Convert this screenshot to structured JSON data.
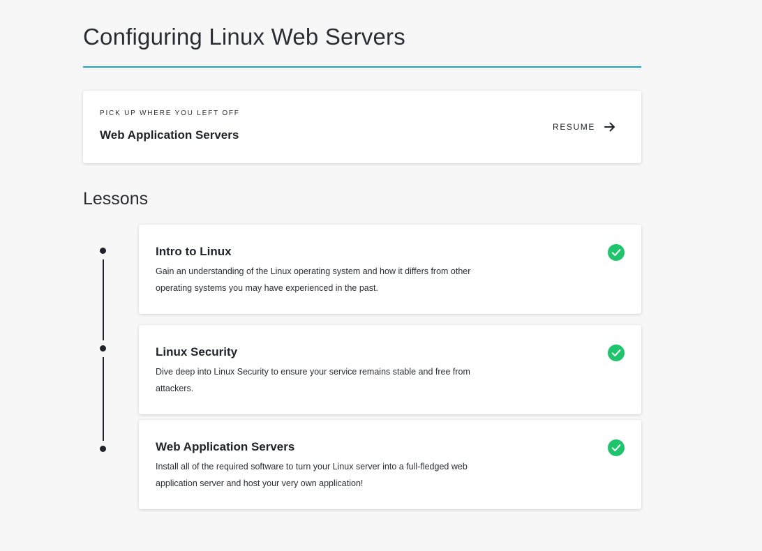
{
  "course": {
    "title": "Configuring Linux Web Servers"
  },
  "resume": {
    "eyebrow": "PICK UP WHERE YOU LEFT OFF",
    "lesson_title": "Web Application Servers",
    "button_label": "RESUME",
    "button_icon": "arrow-right-icon"
  },
  "lessons": {
    "heading": "Lessons",
    "items": [
      {
        "title": "Intro to Linux",
        "description": "Gain an understanding of the Linux operating system and how it differs from other operating systems you may have experienced in the past.",
        "status_icon": "check-circle-icon"
      },
      {
        "title": "Linux Security",
        "description": "Dive deep into Linux Security to ensure your service remains stable and free from attackers.",
        "status_icon": "check-circle-icon"
      },
      {
        "title": "Web Application Servers",
        "description": "Install all of the required software to turn your Linux server into a full-fledged web application server and host your very own application!",
        "status_icon": "check-circle-icon"
      }
    ]
  },
  "colors": {
    "accent_rule": "#1aa3d9",
    "complete_green": "#1fc46d",
    "page_background": "#f7f7f7"
  }
}
